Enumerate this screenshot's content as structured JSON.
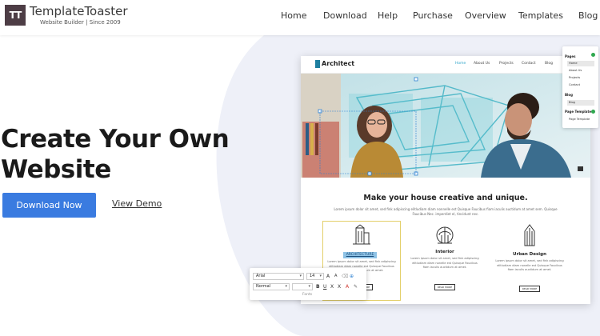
{
  "header": {
    "logo_mark": "TT",
    "brand": "TemplateToaster",
    "tagline": "Website Builder | Since 2009",
    "nav": [
      "Home",
      "Download",
      "Help",
      "Purchase",
      "Overview",
      "Templates",
      "Blog"
    ]
  },
  "hero": {
    "title_line1": "Create Your Own",
    "title_line2": "Website",
    "download_button": "Download Now",
    "demo_link": "View Demo"
  },
  "preview": {
    "logo": "Architect",
    "menu": [
      "Home",
      "About Us",
      "Projects",
      "Contact",
      "Blog"
    ],
    "heading": "Make your house creative and unique.",
    "subtext": "Lorem ipsum dolor sit amet, sed fink adipiscing elitludiam diam nonnelle est Quisque Faucibus fiam iaculis auctidum at amet sem. Quisque Faucibus Nec. imperdiet el, tincidunt nec.",
    "cards": [
      {
        "title": "ARCHITECTURE",
        "icon": "building-icon",
        "desc": "Lorem ipsum dolor sit amet, sed fink adipiscing elitludiam diam nonelle est Quisque Faucibus fiam iaculis auctidum at amet.",
        "button": "READ MORE"
      },
      {
        "title": "Interior",
        "icon": "dome-icon",
        "desc": "Lorem ipsum dolor sit amet, sed fink adipiscing elitludiam diam nonelle est Quisque Faucibus fiam iaculis auctidum at amet.",
        "button": "READ MORE"
      },
      {
        "title": "Urban Design",
        "icon": "tower-icon",
        "desc": "Lorem ipsum dolor sit amet, sed fink adipiscing elitludiam diam nonelle est Quisque Faucibus fiam iaculis auctidum at amet.",
        "button": "READ MORE"
      }
    ]
  },
  "side_panel": {
    "pages_label": "Pages",
    "pages": [
      "Home",
      "About Us",
      "Projects",
      "Contact"
    ],
    "blog_label": "Blog",
    "blog_items": [
      "Blog"
    ],
    "template_label": "Page Template",
    "template_items": [
      "Page Template"
    ]
  },
  "toolbar": {
    "font_family": "Arial",
    "font_size": "14",
    "paragraph_style": "Normal",
    "section_label": "Fonts",
    "buttons": [
      "A",
      "A",
      "U",
      "X",
      "X",
      "A"
    ]
  },
  "colors": {
    "accent": "#3a7be0",
    "logo_bg": "#4d3d45",
    "preview_accent": "#2aa3c9",
    "hero_shape": "#eef0f8"
  }
}
